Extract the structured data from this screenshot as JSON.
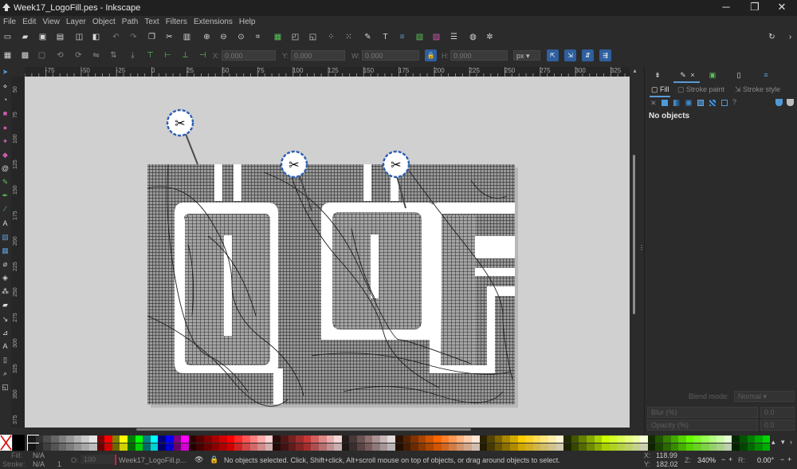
{
  "window": {
    "title": "Week17_LogoFill.pes - Inkscape",
    "controls": [
      "─",
      "❐",
      "✕"
    ]
  },
  "menu": [
    "File",
    "Edit",
    "View",
    "Layer",
    "Object",
    "Path",
    "Text",
    "Filters",
    "Extensions",
    "Help"
  ],
  "toolbar_commands": {
    "icons": [
      "new-icon",
      "open-icon",
      "save-icon",
      "print-icon",
      "import-icon",
      "export-icon",
      "undo-icon",
      "redo-icon",
      "copy-icon",
      "cut-icon",
      "paste-icon",
      "zoom-in-icon",
      "zoom-out-icon",
      "zoom-page-icon",
      "zoom-drawing-icon",
      "duplicate-icon",
      "clone-icon",
      "unlink-icon",
      "group-icon",
      "ungroup-icon",
      "node-editor-icon",
      "text-tool-icon",
      "layers-icon",
      "align-icon",
      "xml-editor-icon",
      "fill-stroke-icon",
      "document-properties-icon",
      "preferences-icon"
    ],
    "right_icons": [
      "rotate-icon",
      "more-icon"
    ]
  },
  "toolbar_select": {
    "x_label": "X:",
    "x_value": "0.000",
    "y_label": "Y:",
    "y_value": "0.000",
    "w_label": "W:",
    "w_value": "0.000",
    "h_label": "H:",
    "h_value": "0.000",
    "unit": "px"
  },
  "hruler_ticks": [
    "-75",
    "-50",
    "-25",
    "0",
    "25",
    "50",
    "75",
    "100",
    "125",
    "150",
    "175",
    "200",
    "225",
    "250",
    "275",
    "300",
    "325"
  ],
  "vruler_ticks": [
    "50",
    "75",
    "100",
    "125",
    "150",
    "175",
    "200",
    "225",
    "250",
    "275",
    "300",
    "325",
    "350",
    "375",
    "400"
  ],
  "right_panel": {
    "tabs": [
      "fill-stroke-tab-icon",
      "close-icon",
      "export-tab-icon",
      "document-tab-icon",
      "layers-tab-icon"
    ],
    "subtabs": [
      "Fill",
      "Stroke paint",
      "Stroke style"
    ],
    "paint_buttons": [
      "✕",
      "flat",
      "linear",
      "radial",
      "mesh",
      "pattern",
      "swatch",
      "?"
    ],
    "no_objects": "No objects",
    "blend_mode_label": "Blend mode:",
    "blend_mode_value": "Normal",
    "blur_label": "Blur (%)",
    "blur_value": "0.0",
    "opacity_label": "Opacity (%)",
    "opacity_value": "0.0"
  },
  "palette": {
    "colors": [
      "#000000",
      "#ffffff",
      "#1a1a1a",
      "#333333",
      "#4d4d4d",
      "#666666",
      "#808080",
      "#999999",
      "#b3b3b3",
      "#cccccc",
      "#e6e6e6",
      "#800000",
      "#ff0000",
      "#808000",
      "#ffff00",
      "#008000",
      "#00ff00",
      "#008080",
      "#00ffff",
      "#000080",
      "#0000ff",
      "#800080",
      "#ff00ff",
      "#2b0000",
      "#550000",
      "#800000",
      "#aa0000",
      "#d40000",
      "#ff0000",
      "#ff2a2a",
      "#ff5555",
      "#ff8080",
      "#ffaaaa",
      "#ffd5d5",
      "#280b0b",
      "#501616",
      "#782121",
      "#a02c2c",
      "#c83737",
      "#d35f5f",
      "#de8787",
      "#e9afaf",
      "#f4d7d7",
      "#241c1c",
      "#483737",
      "#6c5353",
      "#916f6f",
      "#ac9393",
      "#c8b7b7",
      "#e3dbdb",
      "#2b1100",
      "#552200",
      "#803300",
      "#aa4400",
      "#d45500",
      "#ff6600",
      "#ff7f2a",
      "#ff9955",
      "#ffb380",
      "#ffccaa",
      "#ffe6d5",
      "#2b2200",
      "#554400",
      "#806600",
      "#aa8800",
      "#d4aa00",
      "#ffcc00",
      "#ffd42a",
      "#ffdd55",
      "#ffe680",
      "#ffeeaa",
      "#fff6d5",
      "#222b00",
      "#445500",
      "#668000",
      "#88aa00",
      "#aad400",
      "#ccff00",
      "#d4ff2a",
      "#ddff55",
      "#e5ff80",
      "#eeffaa",
      "#f6ffd5",
      "#112b00",
      "#225500",
      "#338000",
      "#44aa00",
      "#55d400",
      "#66ff00",
      "#7fff2a",
      "#99ff55",
      "#b3ff80",
      "#ccffaa",
      "#e5ffd5",
      "#002b00",
      "#005500",
      "#008000",
      "#00aa00",
      "#00d400"
    ]
  },
  "status": {
    "fill_label": "Fill:",
    "fill_value": "N/A",
    "stroke_label": "Stroke:",
    "stroke_value": "N/A",
    "stroke_width": "1",
    "opacity_label": "O:",
    "opacity_value": "100",
    "layer_name": "Week17_LogoFill.p...",
    "message": "No objects selected. Click, Shift+click, Alt+scroll mouse on top of objects, or drag around objects to select.",
    "x_label": "X:",
    "x_value": "118.99",
    "y_label": "Y:",
    "y_value": "182.02",
    "zoom_label": "Z:",
    "zoom_value": "340%",
    "rotation_label": "R:",
    "rotation_value": "0.00°"
  },
  "colors": {
    "accent": "#2f5f9e",
    "panel_bg": "#2b2b2b",
    "canvas_bg": "#d0d0d0",
    "stitch_dark": "#3c3c3c",
    "trim_marker_ring": "#2d5fb3"
  }
}
